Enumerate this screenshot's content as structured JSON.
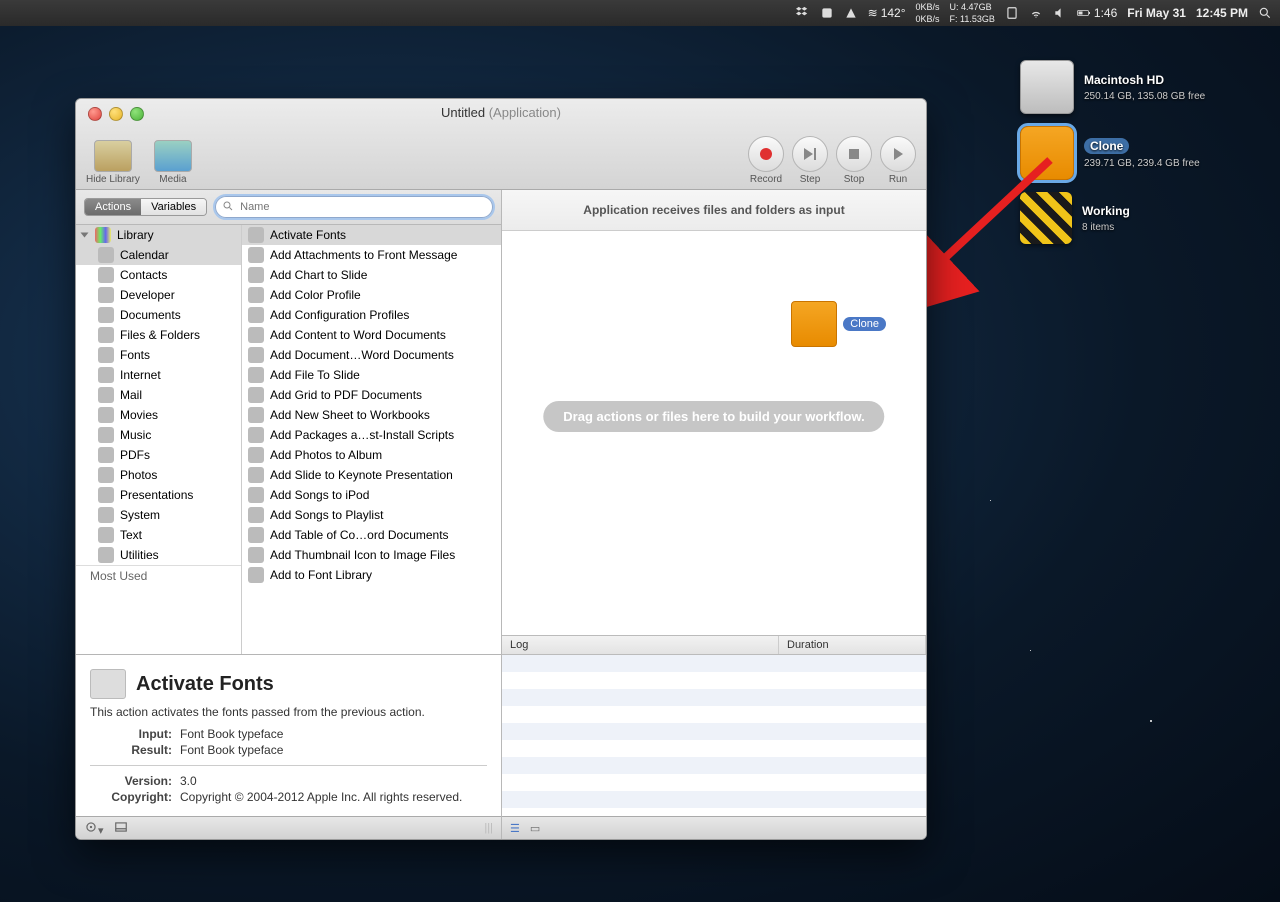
{
  "menubar": {
    "temp": "142°",
    "net_up": "0KB/s",
    "net_down": "0KB/s",
    "mem_u_label": "U:",
    "mem_u": "4.47GB",
    "mem_f_label": "F:",
    "mem_f": "11.53GB",
    "batt_time": "1:46",
    "date": "Fri May 31",
    "clock": "12:45 PM"
  },
  "desktop": {
    "items": [
      {
        "name": "Macintosh HD",
        "sub": "250.14 GB, 135.08 GB free",
        "kind": "hd"
      },
      {
        "name": "Clone",
        "sub": "239.71 GB, 239.4 GB free",
        "kind": "fw",
        "selected": true
      },
      {
        "name": "Working",
        "sub": "8 items",
        "kind": "work"
      }
    ]
  },
  "window": {
    "title_main": "Untitled",
    "title_sub": "(Application)",
    "toolbar": {
      "hide_library": "Hide Library",
      "media": "Media",
      "record": "Record",
      "step": "Step",
      "stop": "Stop",
      "run": "Run"
    },
    "tabs": {
      "actions": "Actions",
      "variables": "Variables"
    },
    "search_placeholder": "Name",
    "library_header": "Library",
    "categories": [
      "Calendar",
      "Contacts",
      "Developer",
      "Documents",
      "Files & Folders",
      "Fonts",
      "Internet",
      "Mail",
      "Movies",
      "Music",
      "PDFs",
      "Photos",
      "Presentations",
      "System",
      "Text",
      "Utilities"
    ],
    "most_used": "Most Used",
    "actions": [
      "Activate Fonts",
      "Add Attachments to Front Message",
      "Add Chart to Slide",
      "Add Color Profile",
      "Add Configuration Profiles",
      "Add Content to Word Documents",
      "Add Document…Word Documents",
      "Add File To Slide",
      "Add Grid to PDF Documents",
      "Add New Sheet to Workbooks",
      "Add Packages a…st-Install Scripts",
      "Add Photos to Album",
      "Add Slide to Keynote Presentation",
      "Add Songs to iPod",
      "Add Songs to Playlist",
      "Add Table of Co…ord Documents",
      "Add Thumbnail Icon to Image Files",
      "Add to Font Library"
    ],
    "detail": {
      "title": "Activate Fonts",
      "desc": "This action activates the fonts passed from the previous action.",
      "input_label": "Input:",
      "input_val": "Font Book typeface",
      "result_label": "Result:",
      "result_val": "Font Book typeface",
      "version_label": "Version:",
      "version_val": "3.0",
      "copyright_label": "Copyright:",
      "copyright_val": "Copyright © 2004-2012 Apple Inc. All rights reserved."
    },
    "workflow": {
      "header": "Application receives files and folders as input",
      "drag_hint": "Drag actions or files here to build your workflow.",
      "drop_label": "Clone",
      "log_col1": "Log",
      "log_col2": "Duration"
    }
  }
}
